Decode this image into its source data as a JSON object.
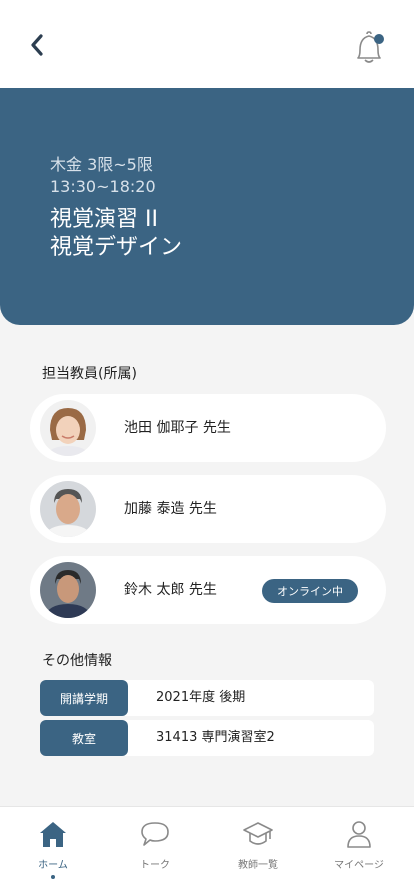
{
  "hero": {
    "schedule": "木金 3限~5限",
    "time": "13:30~18:20",
    "title_line1": "視覚演習 II",
    "title_line2": "視覚デザイン"
  },
  "teachers_section": {
    "label": "担当教員(所属)",
    "teachers": [
      {
        "name": "池田 伽耶子  先生",
        "online": false
      },
      {
        "name": "加藤 泰造  先生",
        "online": false
      },
      {
        "name": "鈴木 太郎  先生",
        "online": true,
        "badge": "オンライン中"
      }
    ]
  },
  "other_info": {
    "label": "その他情報",
    "rows": [
      {
        "key": "開講学期",
        "value": "2021年度 後期"
      },
      {
        "key": "教室",
        "value": "31413 専門演習室2"
      }
    ]
  },
  "tabbar": {
    "tabs": [
      {
        "label": "ホーム",
        "icon": "home-icon",
        "active": true
      },
      {
        "label": "トーク",
        "icon": "chat-bubble-icon",
        "active": false
      },
      {
        "label": "教師一覧",
        "icon": "graduation-cap-icon",
        "active": false
      },
      {
        "label": "マイページ",
        "icon": "user-icon",
        "active": false
      }
    ]
  },
  "colors": {
    "primary": "#3b6483",
    "background": "#f4f4f4",
    "card": "#ffffff"
  }
}
